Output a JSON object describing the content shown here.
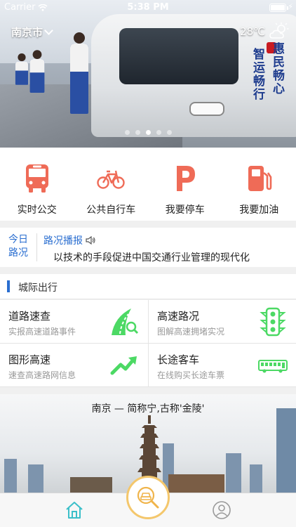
{
  "status_bar": {
    "carrier": "Carrier",
    "time": "5:38 PM"
  },
  "header": {
    "city": "南京市",
    "temperature": "28℃"
  },
  "hero": {
    "slogan_left": "智运畅行",
    "slogan_right": "惠民畅心",
    "carousel_pages": 5,
    "carousel_active_index": 2
  },
  "quick_actions": [
    {
      "label": "实时公交",
      "icon": "bus-icon"
    },
    {
      "label": "公共自行车",
      "icon": "bicycle-icon"
    },
    {
      "label": "我要停车",
      "icon": "parking-icon"
    },
    {
      "label": "我要加油",
      "icon": "fuel-icon"
    }
  ],
  "traffic_news": {
    "today_label": "今日路况",
    "heading": "路况播报",
    "text": "以技术的手段促进中国交通行业管理的现代化"
  },
  "intercity": {
    "title": "城际出行",
    "items": [
      {
        "title": "道路速查",
        "subtitle": "实报高速道路事件",
        "icon": "road-search-icon"
      },
      {
        "title": "高速路况",
        "subtitle": "图解高速拥堵实况",
        "icon": "traffic-light-icon"
      },
      {
        "title": "图形高速",
        "subtitle": "速查高速路网信息",
        "icon": "trend-arrow-icon"
      },
      {
        "title": "长途客车",
        "subtitle": "在线购买长途车票",
        "icon": "coach-bus-icon"
      }
    ]
  },
  "city_banner": {
    "caption": "南京 — 简称宁,古称'金陵'"
  },
  "colors": {
    "accent_blue": "#2a6ed0",
    "quick_icon_red": "#ef6b57",
    "green_icon": "#4cd964",
    "tab_active": "#3bbfc9",
    "center_ring": "#f4c76c"
  }
}
